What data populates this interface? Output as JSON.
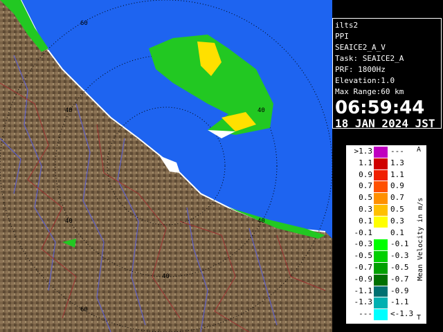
{
  "info": {
    "site": "ilts2",
    "mode": "PPI",
    "product": "SEAICE2_A_V",
    "task": "Task: SEAICE2_A",
    "prf": "PRF: 1800Hz",
    "elevation": "Elevation:1.0",
    "max_range": "Max Range:60 km",
    "time": "06:59:44",
    "date": "18 JAN 2024 JST"
  },
  "range_ring_labels": [
    "60",
    "40",
    "40",
    "40",
    "40",
    "40",
    "60"
  ],
  "legend": {
    "title": "Mean Velocity in m/s",
    "corner_top": "A",
    "corner_bottom": "T",
    "rows": [
      {
        "left": ">1.3",
        "right": "---",
        "color": "#c000c0"
      },
      {
        "left": "1.1",
        "right": "1.3",
        "color": "#d00000"
      },
      {
        "left": "0.9",
        "right": "1.1",
        "color": "#f02000"
      },
      {
        "left": "0.7",
        "right": "0.9",
        "color": "#ff5000"
      },
      {
        "left": "0.5",
        "right": "0.7",
        "color": "#ff9000"
      },
      {
        "left": "0.3",
        "right": "0.5",
        "color": "#ffc000"
      },
      {
        "left": "0.1",
        "right": "0.3",
        "color": "#ffff00"
      },
      {
        "left": "-0.1",
        "right": "0.1",
        "color": "#ffffff"
      },
      {
        "left": "-0.3",
        "right": "-0.1",
        "color": "#00ff00"
      },
      {
        "left": "-0.5",
        "right": "-0.3",
        "color": "#00d000"
      },
      {
        "left": "-0.7",
        "right": "-0.5",
        "color": "#00a000"
      },
      {
        "left": "-0.9",
        "right": "-0.7",
        "color": "#007000"
      },
      {
        "left": "-1.1",
        "right": "-0.9",
        "color": "#007070"
      },
      {
        "left": "-1.3",
        "right": "-1.1",
        "color": "#00b0b0"
      },
      {
        "left": "---",
        "right": "<-1.3",
        "color": "#00ffff"
      }
    ]
  },
  "colors": {
    "sea": "#1e64f0",
    "land": "#7a6347",
    "river": "#6060c0",
    "boundary": "#a03030"
  }
}
